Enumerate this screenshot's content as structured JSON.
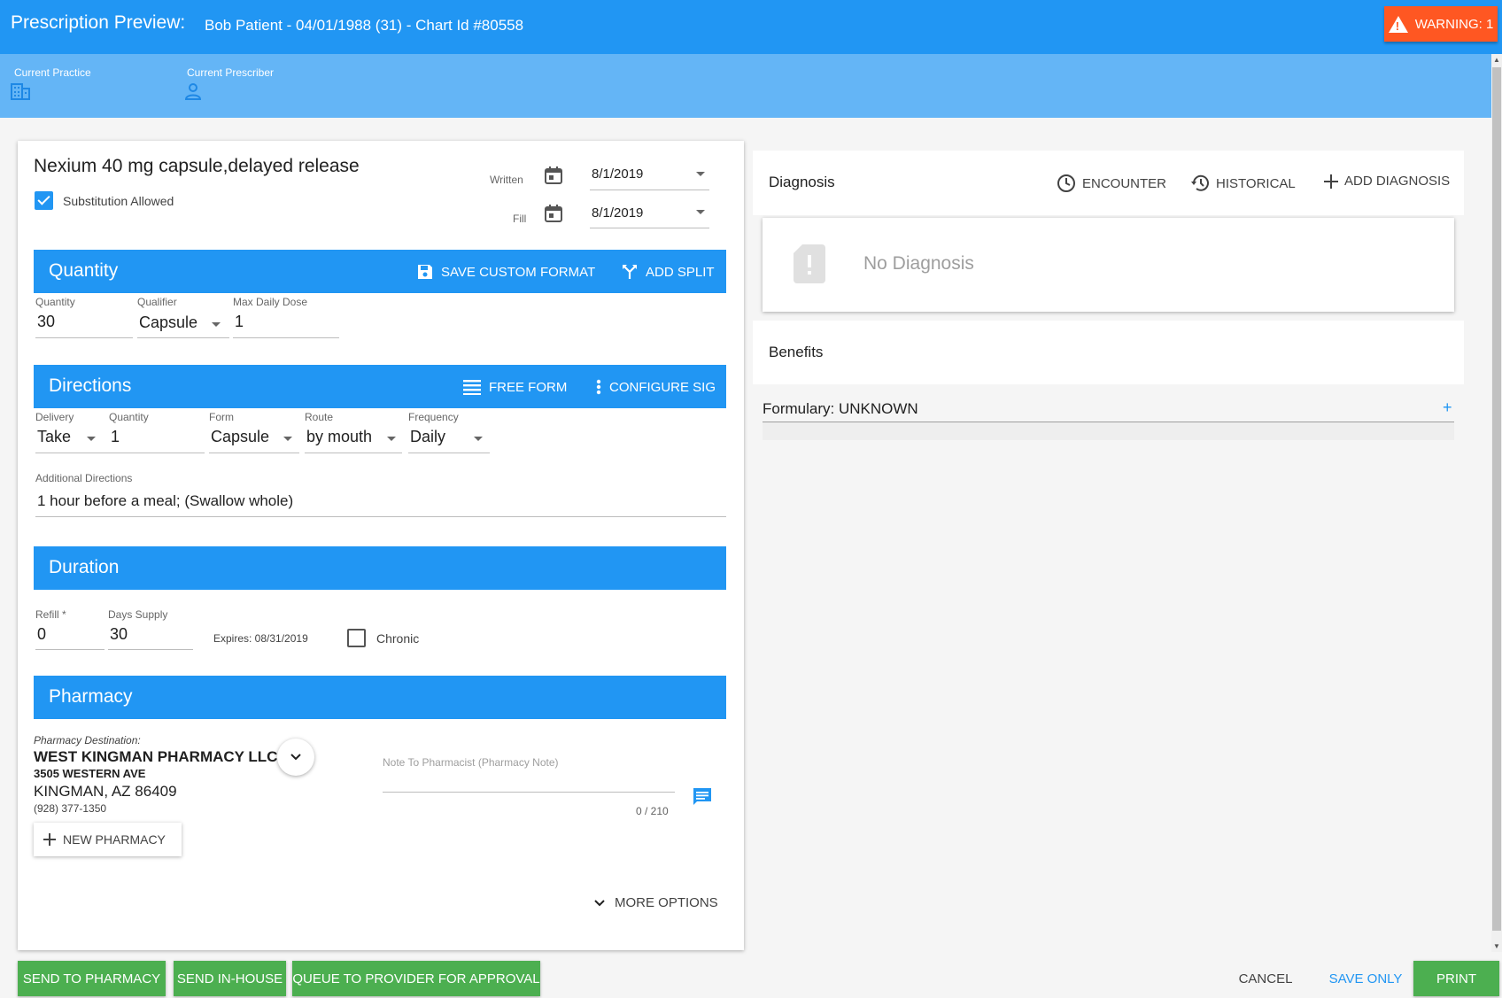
{
  "header": {
    "title": "Prescription Preview:",
    "patient": "Bob Patient - 04/01/1988 (31) - Chart Id #80558",
    "warning_label": "WARNING: 1"
  },
  "subheader": {
    "practice_label": "Current Practice",
    "prescriber_label": "Current Prescriber"
  },
  "drug": {
    "name": "Nexium 40 mg capsule,delayed release",
    "substitution_label": "Substitution Allowed",
    "substitution_checked": true,
    "written_label": "Written",
    "written_date": "8/1/2019",
    "fill_label": "Fill",
    "fill_date": "8/1/2019"
  },
  "quantity": {
    "title": "Quantity",
    "save_custom_format": "SAVE CUSTOM FORMAT",
    "add_split": "ADD SPLIT",
    "quantity_label": "Quantity",
    "quantity_value": "30",
    "qualifier_label": "Qualifier",
    "qualifier_value": "Capsule",
    "max_daily_label": "Max Daily Dose",
    "max_daily_value": "1"
  },
  "directions": {
    "title": "Directions",
    "free_form": "FREE FORM",
    "configure_sig": "CONFIGURE SIG",
    "delivery_label": "Delivery",
    "delivery_value": "Take",
    "quantity_label": "Quantity",
    "quantity_value": "1",
    "form_label": "Form",
    "form_value": "Capsule",
    "route_label": "Route",
    "route_value": "by mouth",
    "frequency_label": "Frequency",
    "frequency_value": "Daily",
    "additional_label": "Additional Directions",
    "additional_value": "1 hour before a meal; (Swallow whole)"
  },
  "duration": {
    "title": "Duration",
    "refill_label": "Refill *",
    "refill_value": "0",
    "days_supply_label": "Days Supply",
    "days_supply_value": "30",
    "expires": "Expires: 08/31/2019",
    "chronic_label": "Chronic",
    "chronic_checked": false
  },
  "pharmacy": {
    "title": "Pharmacy",
    "destination_label": "Pharmacy Destination:",
    "name": "WEST KINGMAN PHARMACY LLC",
    "address": "3505 WESTERN AVE",
    "city": "KINGMAN, AZ 86409",
    "phone": "(928) 377-1350",
    "new_pharmacy": "NEW PHARMACY",
    "note_placeholder": "Note To Pharmacist (Pharmacy Note)",
    "note_counter": "0 / 210",
    "more_options": "MORE OPTIONS"
  },
  "diagnosis": {
    "title": "Diagnosis",
    "encounter": "ENCOUNTER",
    "historical": "HISTORICAL",
    "add_diagnosis": "ADD DIAGNOSIS",
    "empty_text": "No Diagnosis"
  },
  "benefits": {
    "title": "Benefits",
    "formulary": "Formulary: UNKNOWN",
    "expand": "+"
  },
  "footer": {
    "send_to_pharmacy": "SEND TO PHARMACY",
    "send_in_house": "SEND IN-HOUSE",
    "queue_to_provider": "QUEUE TO PROVIDER FOR APPROVAL",
    "cancel": "CANCEL",
    "save_only": "SAVE ONLY",
    "print": "PRINT"
  },
  "colors": {
    "primary": "#2196f3",
    "primary_light": "#64b5f6",
    "warning": "#ff5722",
    "success": "#4caf50"
  }
}
